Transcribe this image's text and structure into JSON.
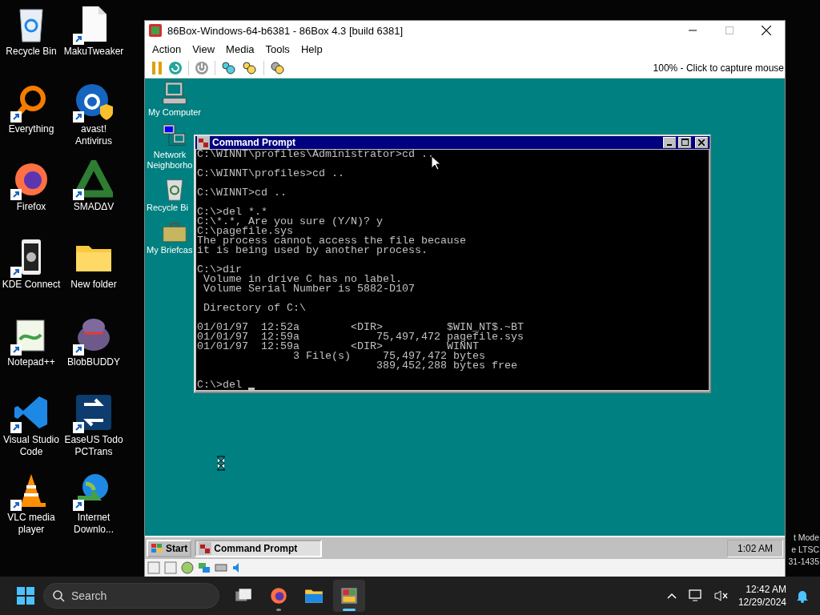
{
  "desktop_icons": [
    {
      "label": "Recycle Bin",
      "shortcut": false
    },
    {
      "label": "MakuTweaker",
      "shortcut": true
    },
    {
      "label": "Everything",
      "shortcut": true
    },
    {
      "label": "avast! Antivirus",
      "shortcut": true
    },
    {
      "label": "Firefox",
      "shortcut": true
    },
    {
      "label": "SMADΔV",
      "shortcut": true
    },
    {
      "label": "KDE Connect",
      "shortcut": true
    },
    {
      "label": "New folder",
      "shortcut": false
    },
    {
      "label": "Notepad++",
      "shortcut": true
    },
    {
      "label": "BlobBUDDY",
      "shortcut": true
    },
    {
      "label": "Visual Studio Code",
      "shortcut": true
    },
    {
      "label": "EaseUS Todo PCTrans",
      "shortcut": true
    },
    {
      "label": "VLC media player",
      "shortcut": true
    },
    {
      "label": "Internet Downlo...",
      "shortcut": true
    }
  ],
  "os_notice_fragments": [
    "t Mode",
    "e LTSC",
    "31-1435"
  ],
  "emulator_window": {
    "title": "86Box-Windows-64-b6381 - 86Box 4.3 [build 6381]",
    "menu": [
      "Action",
      "View",
      "Media",
      "Tools",
      "Help"
    ],
    "status_text": "100% - Click to capture mouse",
    "guest_desktop": {
      "icons": [
        {
          "label": "My Computer"
        },
        {
          "label": "Network Neighborho"
        },
        {
          "label": "Recycle Bi"
        },
        {
          "label": "My Briefcas"
        }
      ],
      "console_window": {
        "title": "Command Prompt",
        "blocks": [
          [
            "C:\\WINNT\\profiles\\Administrator>cd .."
          ],
          [
            "C:\\WINNT\\profiles>cd .."
          ],
          [
            "C:\\WINNT>cd .."
          ],
          [
            "C:\\>del *.*",
            "C:\\*.*, Are you sure (Y/N)? y",
            "C:\\pagefile.sys",
            "The process cannot access the file because",
            "it is being used by another process."
          ],
          [
            "C:\\>dir",
            " Volume in drive C has no label.",
            " Volume Serial Number is 5882-D107"
          ],
          [
            " Directory of C:\\"
          ],
          [
            "01/01/97  12:52a        <DIR>          $WIN_NT$.~BT",
            "01/01/97  12:59a            75,497,472 pagefile.sys",
            "01/01/97  12:59a        <DIR>          WINNT",
            "               3 File(s)     75,497,472 bytes",
            "                            389,452,288 bytes free"
          ],
          [
            "C:\\>del"
          ]
        ]
      },
      "taskbar": {
        "start_label": "Start",
        "tasks": [
          {
            "label": "Command Prompt",
            "selected": true
          }
        ],
        "clock": "1:02 AM"
      }
    }
  },
  "taskbar": {
    "search_placeholder": "Search",
    "apps": [
      {
        "selected": false
      },
      {
        "selected": false
      },
      {
        "selected": false
      },
      {
        "selected": true
      }
    ],
    "time": "12:42 AM",
    "date": "12/29/2024"
  }
}
